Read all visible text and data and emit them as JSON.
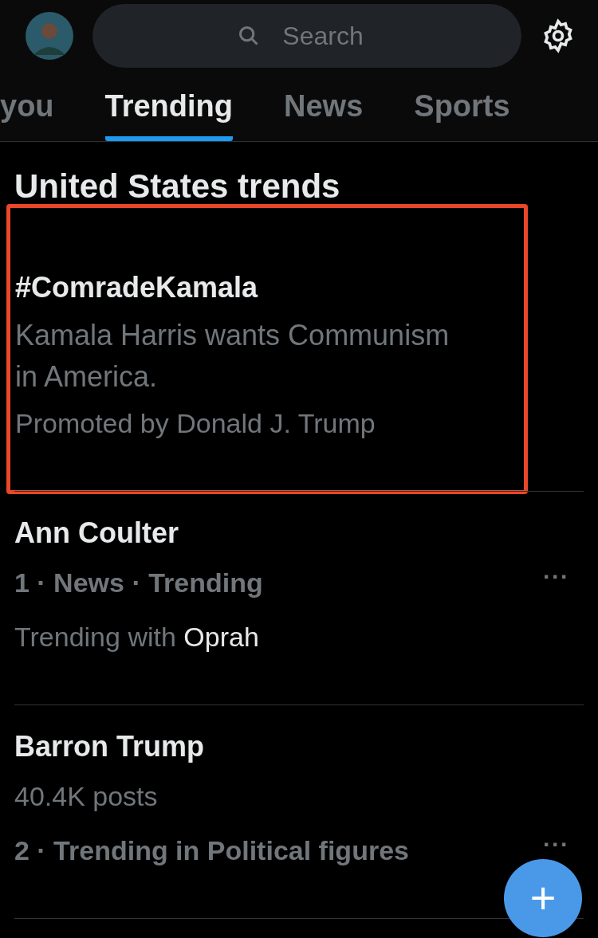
{
  "header": {
    "search": {
      "placeholder": "Search"
    }
  },
  "tabs": [
    {
      "label": "you",
      "selected": false
    },
    {
      "label": "Trending",
      "selected": true
    },
    {
      "label": "News",
      "selected": false
    },
    {
      "label": "Sports",
      "selected": false
    }
  ],
  "section_title": "United States trends",
  "trends": [
    {
      "kind": "promoted",
      "highlighted": true,
      "title": "#ComradeKamala",
      "description": "Kamala Harris wants Communism in America.",
      "promoter": "Promoted by Donald J. Trump"
    },
    {
      "kind": "trend",
      "highlighted": false,
      "title": "Ann Coulter",
      "meta": "1 · News · Trending",
      "with_prefix": "Trending with",
      "with_name": "Oprah",
      "more": "···"
    },
    {
      "kind": "trend",
      "highlighted": false,
      "title": "Barron Trump",
      "posts": "40.4K posts",
      "meta": "2 · Trending in Political figures",
      "more": "···"
    }
  ],
  "fab": {
    "label": "+"
  }
}
